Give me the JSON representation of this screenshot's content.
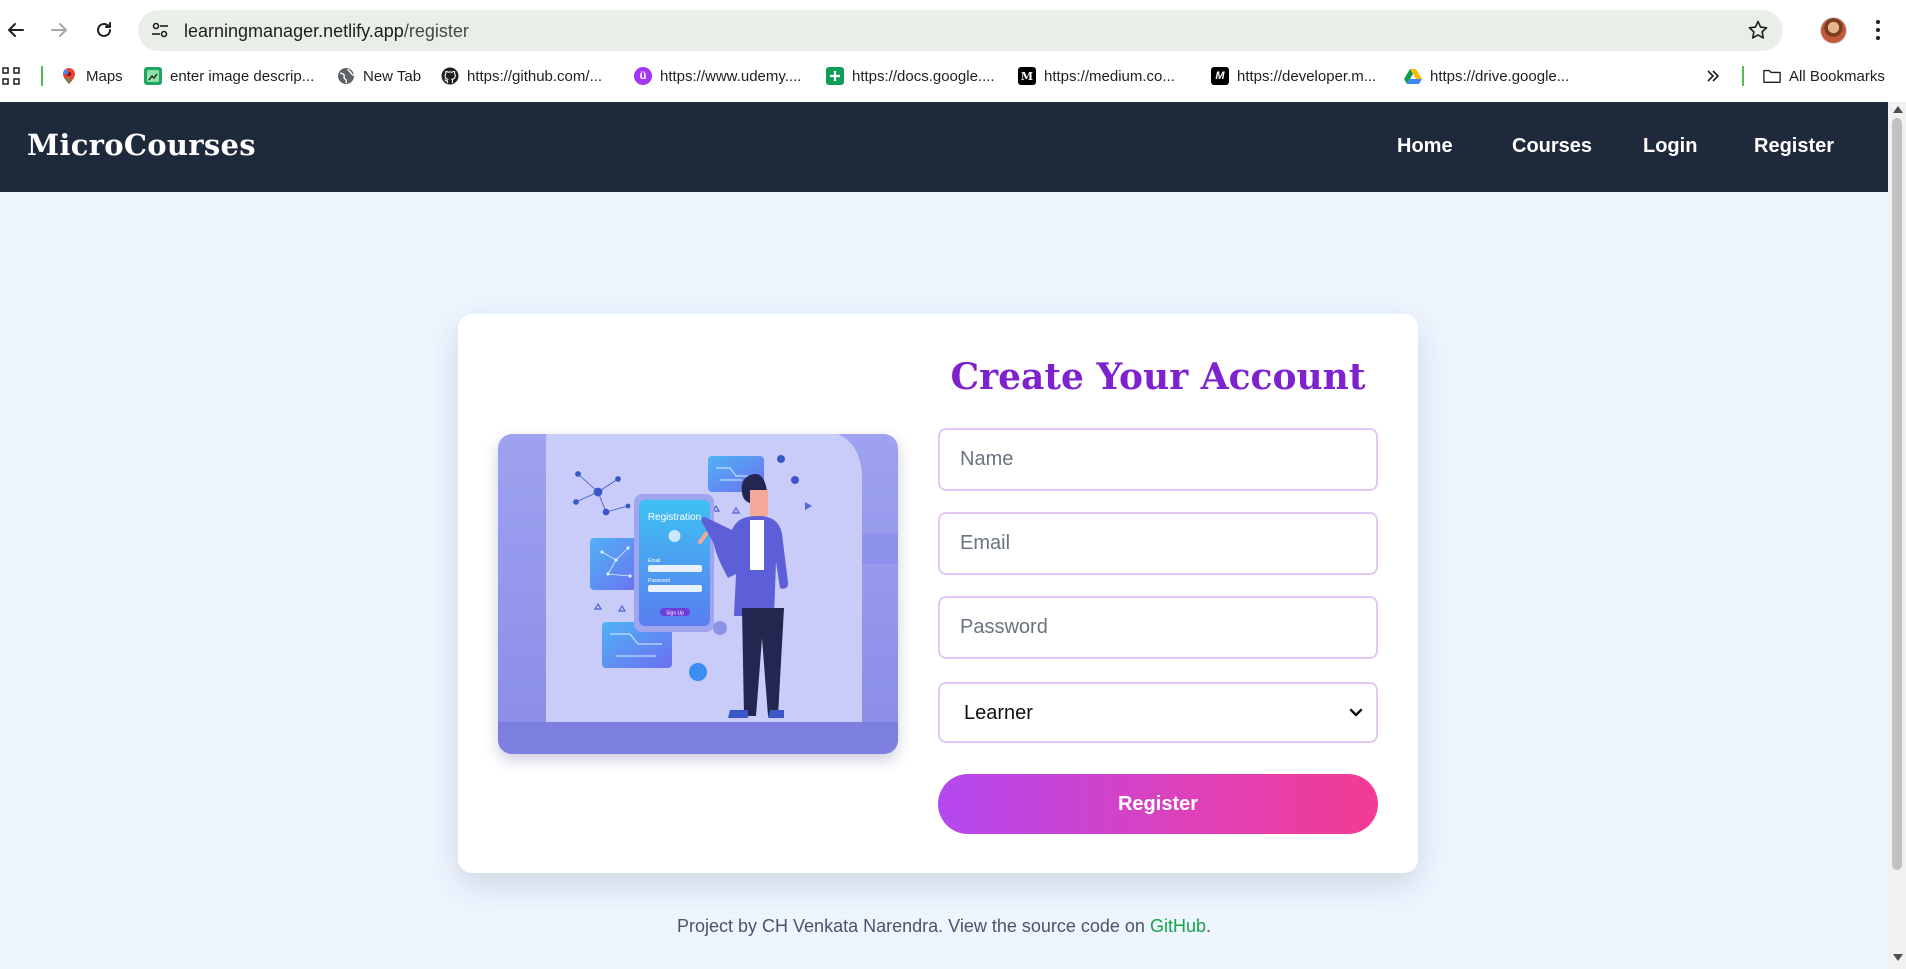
{
  "browser": {
    "url_host": "learningmanager.netlify.app",
    "url_path": "/register",
    "bookmarks": [
      {
        "label": "Maps",
        "icon": "maps-icon"
      },
      {
        "label": "enter image descrip...",
        "icon": "image-bookmark-icon"
      },
      {
        "label": "New Tab",
        "icon": "globe-icon"
      },
      {
        "label": "https://github.com/...",
        "icon": "github-icon"
      },
      {
        "label": "https://www.udemy....",
        "icon": "udemy-icon"
      },
      {
        "label": "https://docs.google....",
        "icon": "google-sheets-icon"
      },
      {
        "label": "https://medium.co...",
        "icon": "medium-icon"
      },
      {
        "label": "https://developer.m...",
        "icon": "mdn-icon"
      },
      {
        "label": "https://drive.google...",
        "icon": "google-drive-icon"
      }
    ],
    "all_bookmarks_label": "All Bookmarks"
  },
  "header": {
    "brand": "MicroCourses",
    "nav": [
      "Home",
      "Courses",
      "Login",
      "Register"
    ]
  },
  "form": {
    "title": "Create Your Account",
    "name_placeholder": "Name",
    "email_placeholder": "Email",
    "password_placeholder": "Password",
    "role_selected": "Learner",
    "submit_label": "Register",
    "illustration": {
      "screen_title": "Registration",
      "field_1": "Email",
      "field_2": "Password",
      "button": "Sign Up"
    }
  },
  "footer": {
    "text_before": "Project by CH Venkata Narendra. View the source code on ",
    "link": "GitHub",
    "text_after": "."
  },
  "colors": {
    "header_bg": "#1e293b",
    "page_bg": "#eef5ff",
    "title": "#7e22ce",
    "button_gradient_start": "#b348f0",
    "button_gradient_end": "#f23b93",
    "footer_link": "#16a34a"
  }
}
